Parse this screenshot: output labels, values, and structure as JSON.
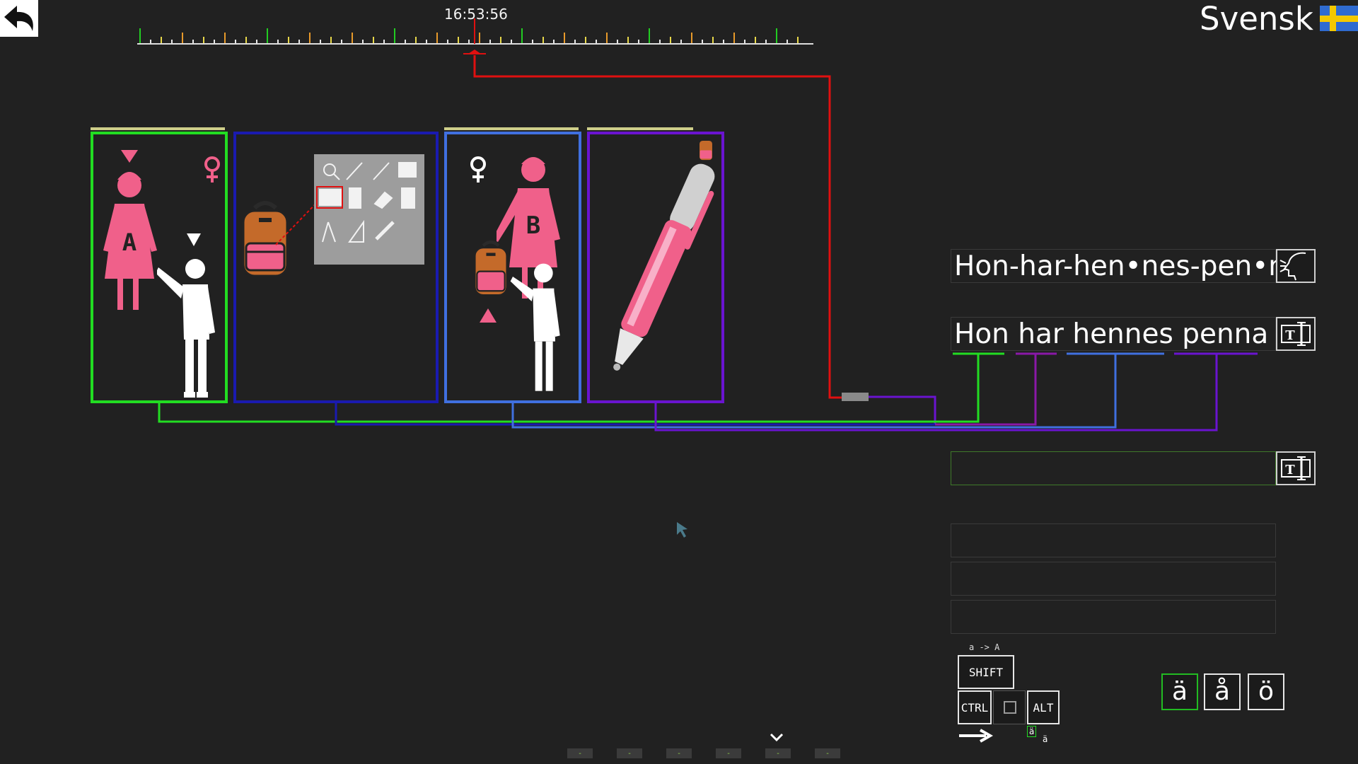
{
  "header": {
    "clock": "16:53:56",
    "language": "Svensk",
    "back_label": ""
  },
  "sentence": {
    "syllables": "Hon-har-hen•nes-pen•na",
    "words": "Hon har hennes penna",
    "input_value": "",
    "extra_rows": [
      "",
      "",
      ""
    ]
  },
  "keyboard": {
    "case_hint": "a -> A",
    "shift": "SHIFT",
    "ctrl": "CTRL",
    "alt": "ALT",
    "accent_hint_a": "ä",
    "accent_hint_b": "ä"
  },
  "special_chars": [
    "ä",
    "å",
    "ö"
  ],
  "pager": {
    "count": 6,
    "dash": "-"
  },
  "colors": {
    "background": "#212121",
    "green": "#22dd22",
    "navy": "#1a1ab0",
    "blue": "#4070e0",
    "purple": "#6a14d0",
    "red": "#e01010",
    "pink": "#f0608a",
    "brown": "#c46a2a"
  },
  "icons": [
    "back-arrow-icon",
    "swedish-flag-icon",
    "speak-icon",
    "text-icon",
    "woman-a-icon",
    "man-pointing-icon",
    "female-symbol-icon",
    "backpack-icon",
    "school-supplies-icon",
    "woman-b-icon",
    "pen-icon"
  ]
}
